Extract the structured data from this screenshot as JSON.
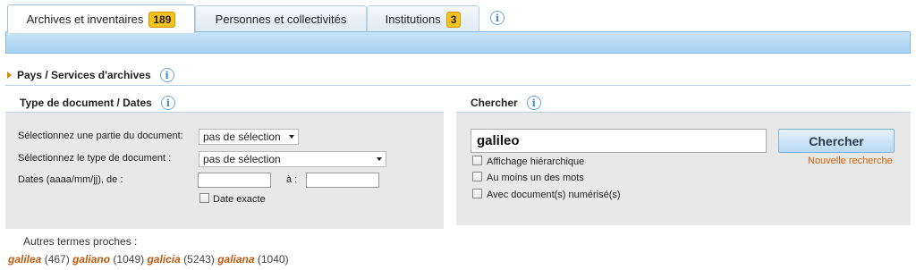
{
  "tabs": [
    {
      "label": "Archives et inventaires",
      "badge": "189"
    },
    {
      "label": "Personnes et collectivités"
    },
    {
      "label": "Institutions",
      "badge": "3"
    }
  ],
  "info_glyph": "i",
  "pays": {
    "label": "Pays / Services d'archives"
  },
  "type_panel": {
    "title": "Type de document / Dates",
    "partie_label": "Sélectionnez une partie du document:",
    "partie_value": "pas de sélection",
    "type_label": "Sélectionnez le type de document :",
    "type_value": "pas de sélection",
    "dates_label": "Dates (aaaa/mm/jj), de :",
    "dates_a": "à :",
    "date_exacte": "Date exacte"
  },
  "search_panel": {
    "title": "Chercher",
    "query": "galileo",
    "button": "Chercher",
    "new_search": "Nouvelle recherche",
    "options": [
      "Affichage hiérarchique",
      "Au moins un des mots",
      "Avec document(s) numérisé(s)"
    ]
  },
  "autres": {
    "label": "Autres termes proches :",
    "terms": [
      {
        "term": "galilea",
        "count": "(467)"
      },
      {
        "term": "galiano",
        "count": "(1049)"
      },
      {
        "term": "galicia",
        "count": "(5243)"
      },
      {
        "term": "galiana",
        "count": "(1040)"
      }
    ]
  },
  "colors": {
    "badge": "#f6c21b",
    "tabbar": "#b4d9f3",
    "link": "#c05a12",
    "panel": "#e8e8e8"
  }
}
